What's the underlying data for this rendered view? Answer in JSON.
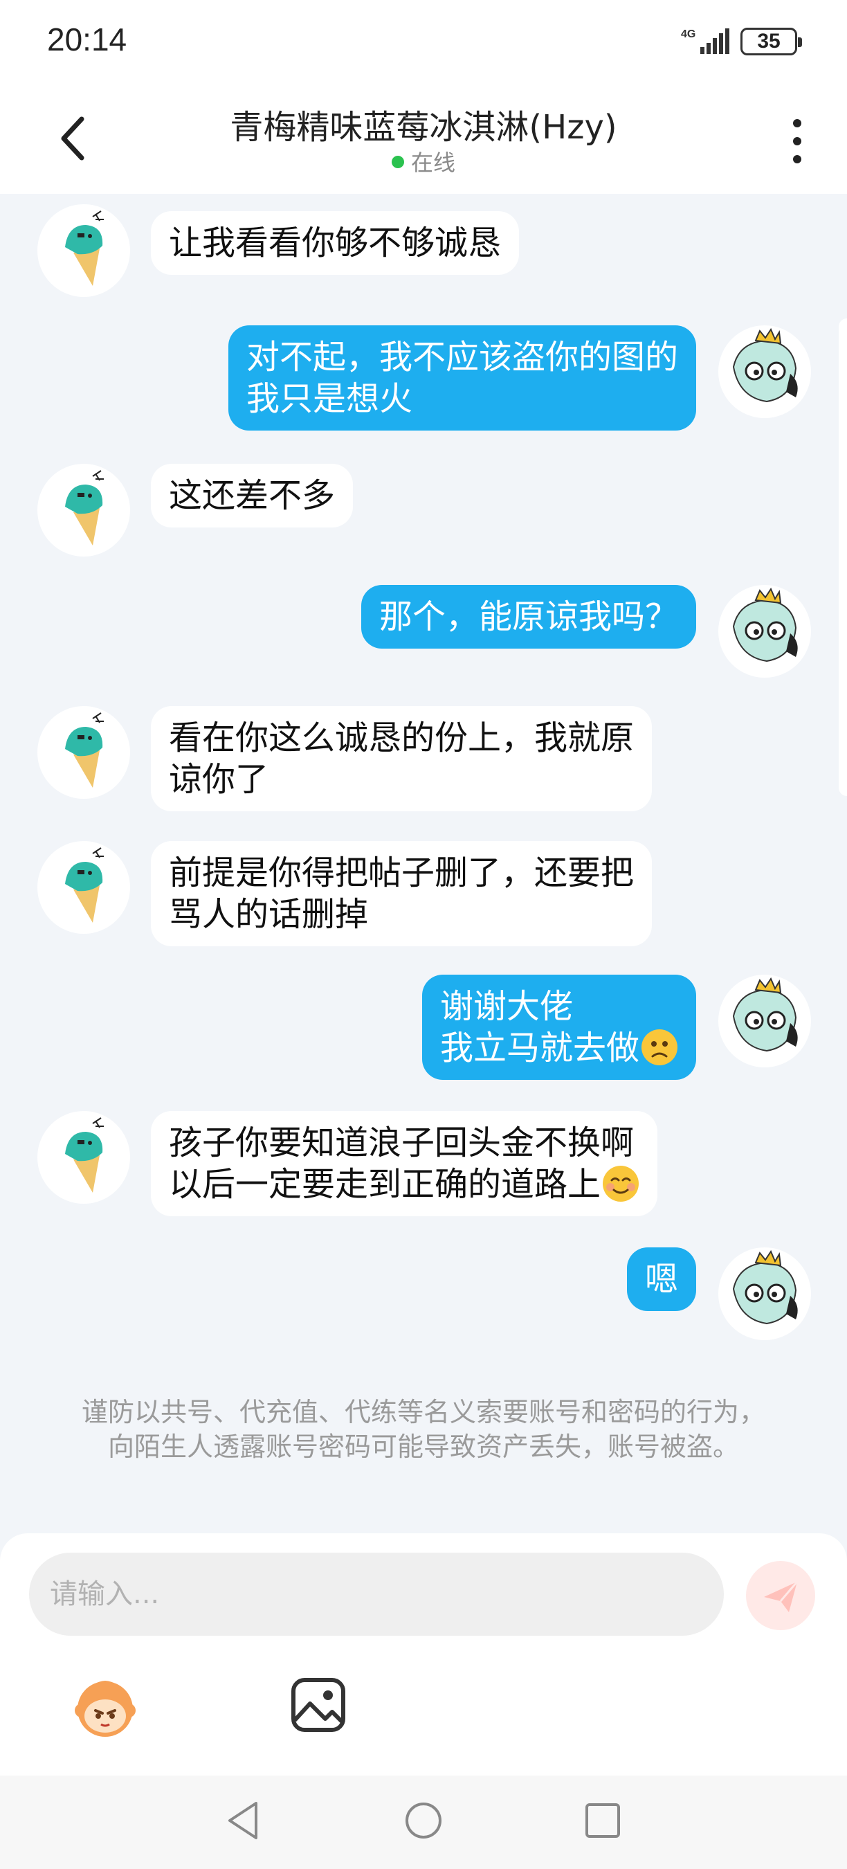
{
  "status_bar": {
    "time": "20:14",
    "network": "4G",
    "battery": "35"
  },
  "header": {
    "title": "青梅精味蓝莓冰淇淋(Hzy)",
    "status": "在线"
  },
  "messages": [
    {
      "side": "left",
      "text": "让我看看你够不够诚恳"
    },
    {
      "side": "right",
      "text": "对不起，我不应该盗你的图的\n我只是想火"
    },
    {
      "side": "left",
      "text": "这还差不多"
    },
    {
      "side": "right",
      "text": "那个，能原谅我吗？"
    },
    {
      "side": "left",
      "text": "看在你这么诚恳的份上，我就原\n谅你了"
    },
    {
      "side": "left",
      "text": "前提是你得把帖子删了，还要把\n骂人的话删掉"
    },
    {
      "side": "right",
      "text": "谢谢大佬\n我立马就去做",
      "emoji": "sad-face"
    },
    {
      "side": "left",
      "text": "孩子你要知道浪子回头金不换啊\n以后一定要走到正确的道路上",
      "emoji": "smiling-face"
    },
    {
      "side": "right",
      "text": "嗯"
    }
  ],
  "safety_notice": "谨防以共号、代充值、代练等名义索要账号和密码的行为，向陌生人透露账号密码可能导致资产丢失，账号被盗。",
  "input": {
    "placeholder": "请输入..."
  },
  "icons": {
    "back": "back-arrow-icon",
    "more": "more-vertical-icon",
    "send": "send-icon",
    "emoji": "emoji-icon",
    "image": "image-icon",
    "nav_back": "nav-back-icon",
    "nav_home": "nav-home-icon",
    "nav_recent": "nav-recent-icon"
  },
  "colors": {
    "accent": "#1eaeef",
    "online": "#2bc24f",
    "background": "#f2f5f9"
  }
}
